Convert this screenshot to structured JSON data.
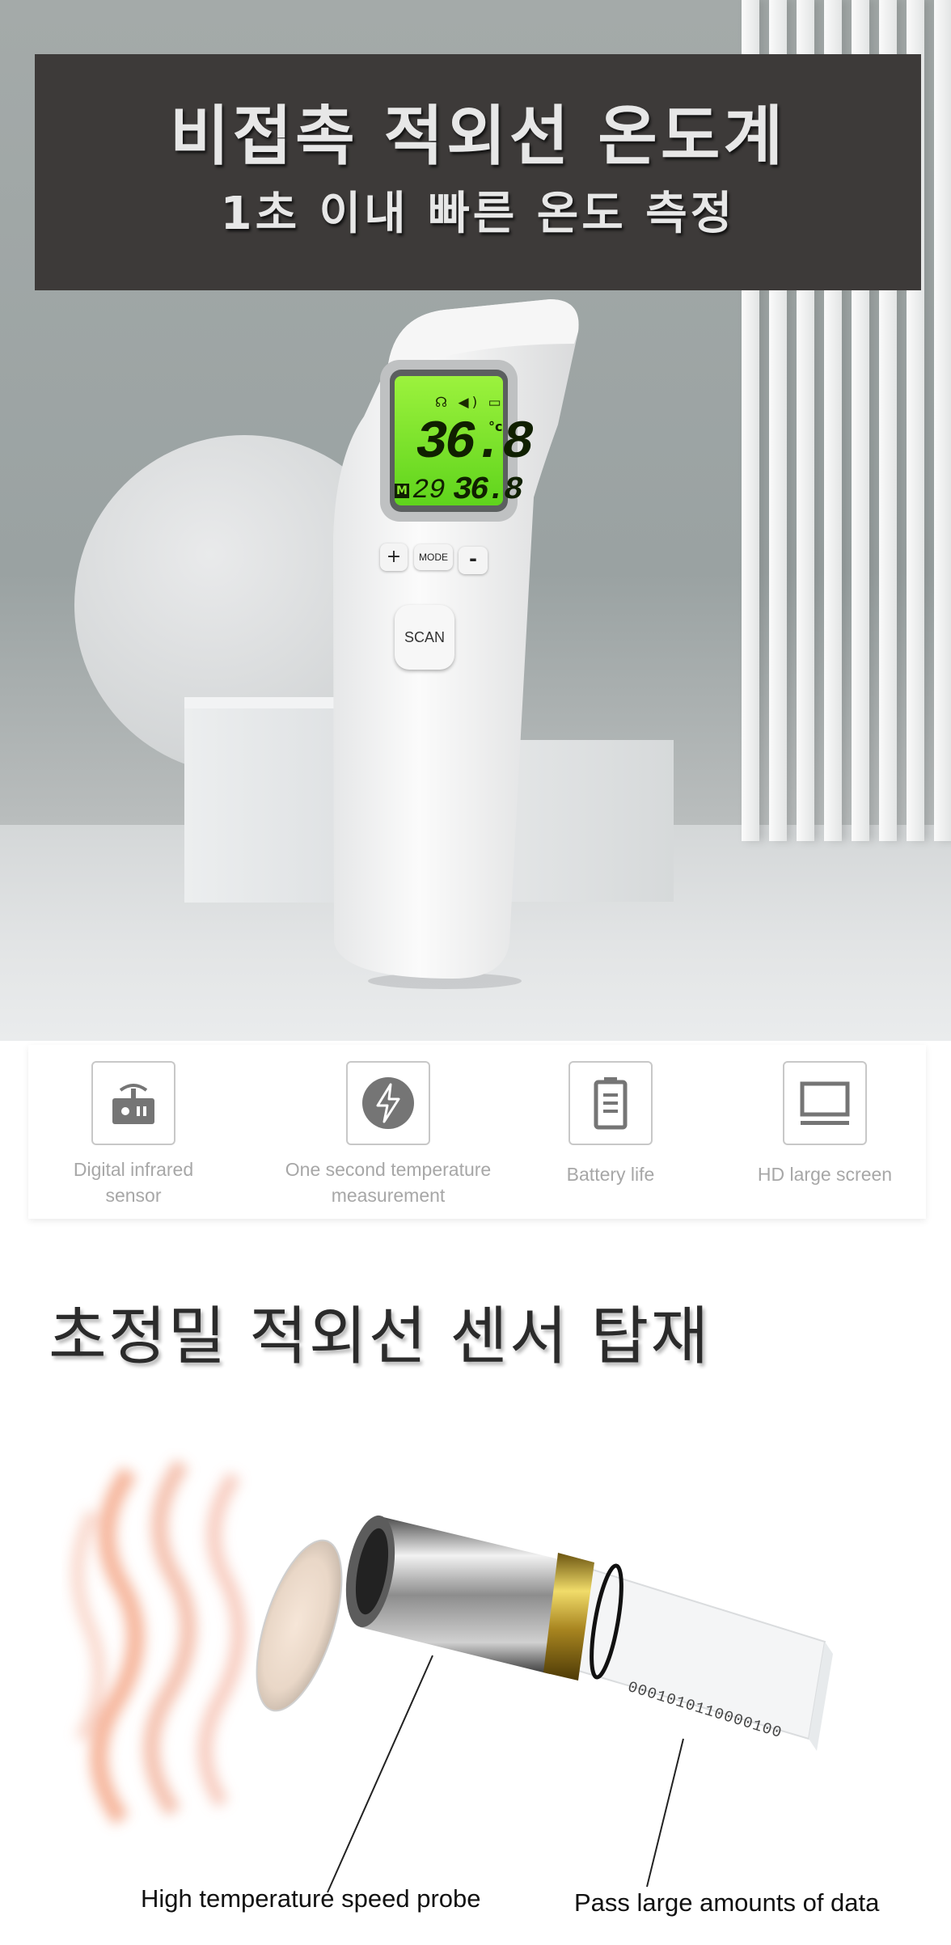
{
  "banner": {
    "title": "비접촉 적외선 온도계",
    "subtitle": "1초 이내 빠른 온도 측정",
    "background_color": "#3d3a39"
  },
  "device": {
    "display_main": "36.8",
    "display_unit": "°c",
    "display_memory_badge": "M",
    "display_memory_index": "29",
    "display_memory_value": "36.8",
    "display_color": "#7fe82a",
    "button_plus": "+",
    "button_mode": "MODE",
    "button_minus": "-",
    "button_scan": "SCAN"
  },
  "features": [
    {
      "icon": "infrared-sensor-icon",
      "label_line1": "Digital infrared",
      "label_line2": "sensor"
    },
    {
      "icon": "lightning-icon",
      "label_line1": "One second temperature",
      "label_line2": "measurement"
    },
    {
      "icon": "battery-icon",
      "label_line1": "Battery life",
      "label_line2": ""
    },
    {
      "icon": "monitor-icon",
      "label_line1": "HD large screen",
      "label_line2": ""
    }
  ],
  "section": {
    "title": "초정밀 적외선 센서 탑재"
  },
  "probe": {
    "binary_text": "0001010110000100",
    "label_left": "High temperature speed probe",
    "label_right": "Pass large amounts of data"
  }
}
